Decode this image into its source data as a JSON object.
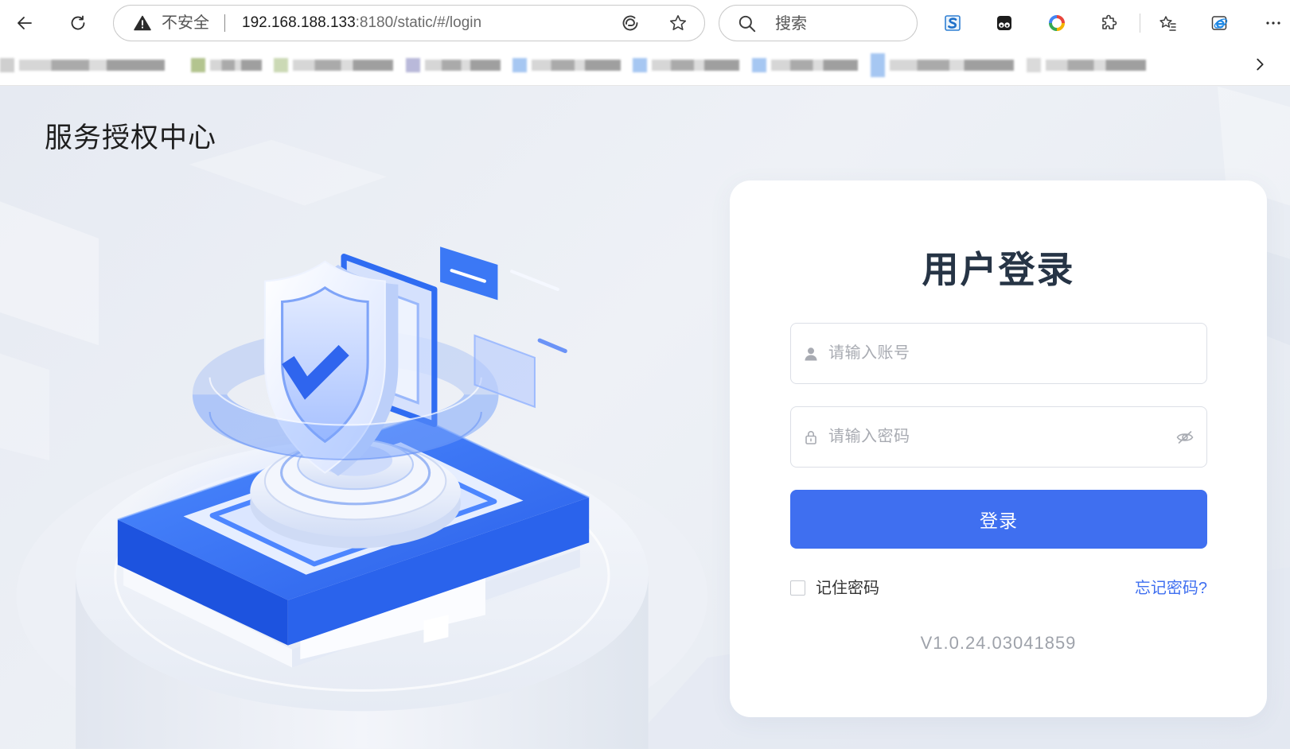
{
  "browser": {
    "address_bar": {
      "security_label": "不安全",
      "url_host": "192.168.188.133",
      "url_path": ":8180/static/#/login"
    },
    "search_box": {
      "placeholder": "搜索"
    },
    "icons": {
      "back": "arrow-left-icon",
      "refresh": "refresh-icon",
      "security": "warning-triangle-icon",
      "address_action": "read-aloud-icon",
      "favorite": "star-icon",
      "search": "search-icon",
      "extensions": [
        "s-extension-icon",
        "tampermonkey-extension-icon",
        "color-ring-extension-icon",
        "extensions-puzzle-icon"
      ],
      "favorites": "favorites-icon",
      "ie_mode": "ie-mode-icon",
      "more": "more-icon",
      "bookmarks_overflow": "chevron-right-icon"
    }
  },
  "page": {
    "brand_title": "服务授权中心",
    "login": {
      "title": "用户登录",
      "username_placeholder": "请输入账号",
      "password_placeholder": "请输入密码",
      "submit_label": "登录",
      "remember_label": "记住密码",
      "forgot_label": "忘记密码?",
      "version": "V1.0.24.03041859",
      "icons": {
        "username": "user-icon",
        "password": "lock-icon",
        "toggle_password": "eye-off-icon"
      }
    }
  },
  "colors": {
    "accent": "#3f6ff0",
    "title_text": "#263445",
    "placeholder": "#a8abb2",
    "version_text": "#9ea2aa",
    "page_background": "#e9edf4"
  }
}
